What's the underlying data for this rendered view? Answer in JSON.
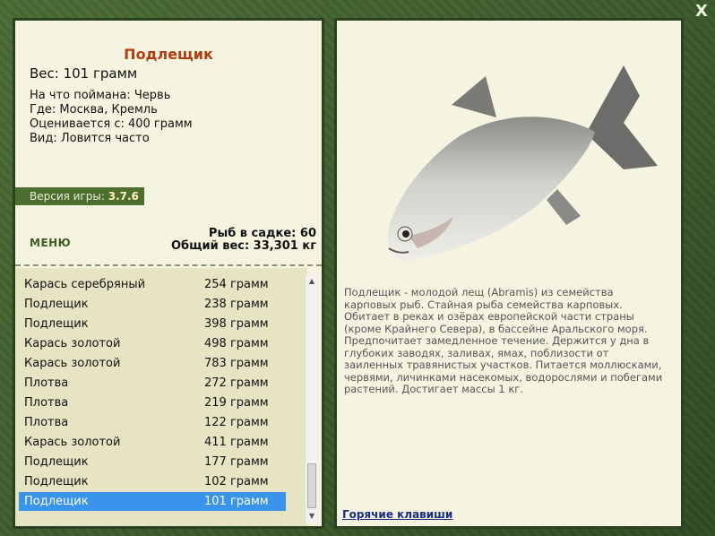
{
  "fish": {
    "name": "Подлещик",
    "weight": "Вес: 101 грамм",
    "bait": "На что поймана: Червь",
    "place": "Где: Москва, Кремль",
    "price": "Оценивается с: 400 грамм",
    "kind": "Вид: Ловится часто",
    "description": "Подлещик - молодой лещ (Abramis) из семейства карповых рыб. Стайная рыба семейства карповых. Обитает в реках и озёрах европейской части страны (кроме Крайнего Севера), в бассейне Аральского моря. Предпочитает замедленное течение. Держится у дна в глубоких заводях, заливах, ямах, поблизости от заиленных травянистых участков. Питается моллюсками, червями, личинками насекомых, водорослями и побегами растений. Достигает массы 1 кг."
  },
  "version": {
    "label": "Версия игры:",
    "value": "3.7.6"
  },
  "menu_label": "МЕНЮ",
  "stats": {
    "count": "Рыб в садке: 60",
    "total": "Общий вес: 33,301 кг"
  },
  "catch_list": [
    {
      "name": "Карась серебряный",
      "weight": "254 грамм"
    },
    {
      "name": "Подлещик",
      "weight": "238 грамм"
    },
    {
      "name": "Подлещик",
      "weight": "398 грамм"
    },
    {
      "name": "Карась золотой",
      "weight": "498 грамм"
    },
    {
      "name": "Карась золотой",
      "weight": "783 грамм"
    },
    {
      "name": "Плотва",
      "weight": "272 грамм"
    },
    {
      "name": "Плотва",
      "weight": "219 грамм"
    },
    {
      "name": "Плотва",
      "weight": "122 грамм"
    },
    {
      "name": "Карась золотой",
      "weight": "411 грамм"
    },
    {
      "name": "Подлещик",
      "weight": "177 грамм"
    },
    {
      "name": "Подлещик",
      "weight": "102 грамм"
    },
    {
      "name": "Подлещик",
      "weight": "101 грамм"
    }
  ],
  "selected_index": 11,
  "hotkeys_label": "Горячие клавиши",
  "close_label": "X"
}
